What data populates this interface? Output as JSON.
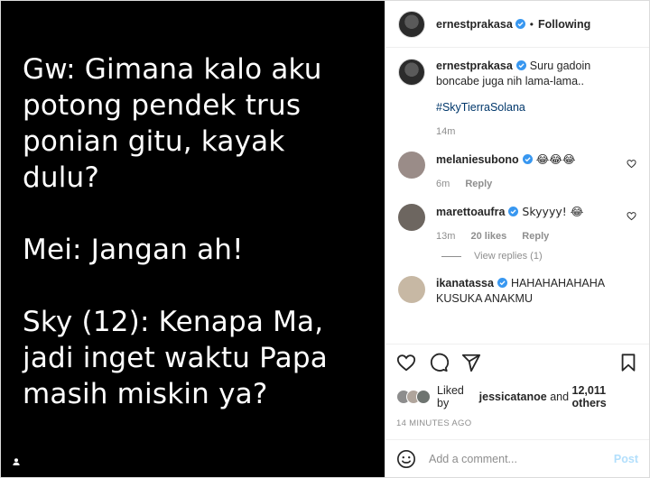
{
  "media": {
    "lines": [
      "Gw: Gimana kalo aku\npotong pendek trus\nponian gitu, kayak\ndulu?",
      "Mei: Jangan ah!",
      "Sky (12): Kenapa Ma,\njadi inget waktu Papa\nmasih miskin ya?"
    ],
    "tag_icon": "user-tag-icon"
  },
  "header": {
    "username": "ernestprakasa",
    "separator": "•",
    "follow_label": "Following"
  },
  "caption": {
    "username": "ernestprakasa",
    "text": "Suru gadoin boncabe juga nih lama-lama..",
    "hashtag": "#SkyTierraSolana",
    "time": "14m"
  },
  "comments": [
    {
      "username": "melaniesubono",
      "text": "😂😂😂",
      "time": "6m",
      "likes": "",
      "reply_label": "Reply",
      "avatar_color": "#9a8c88"
    },
    {
      "username": "marettoaufra",
      "text": "Skyyyy! 😂",
      "time": "13m",
      "likes": "20 likes",
      "reply_label": "Reply",
      "avatar_color": "#6d6660",
      "view_replies": "View replies (1)"
    },
    {
      "username": "ikanatassa",
      "text": "HAHAHAHAHAHA KUSUKA ANAKMU",
      "time": "",
      "likes": "",
      "reply_label": "",
      "avatar_color": "#c7b8a4"
    }
  ],
  "likes": {
    "prefix": "Liked by",
    "user": "jessicatanoe",
    "middle": "and",
    "count": "12,011 others"
  },
  "timestamp": "14 MINUTES AGO",
  "add_comment": {
    "placeholder": "Add a comment...",
    "post_label": "Post"
  },
  "colors": {
    "verified": "#3897f0",
    "link": "#00376b",
    "muted": "#8e8e8e",
    "post_disabled": "#b2dffc"
  }
}
